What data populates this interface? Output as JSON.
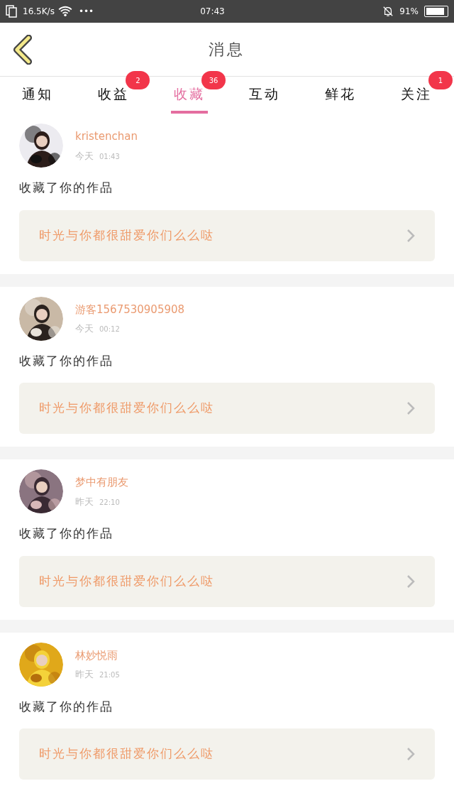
{
  "status_bar": {
    "speed": "16.5K/s",
    "dots": "•••",
    "time": "07:43",
    "battery": "91%"
  },
  "header": {
    "title": "消息"
  },
  "tabs": [
    {
      "label": "通知",
      "selected": false
    },
    {
      "label": "收益",
      "selected": false,
      "badge": "2"
    },
    {
      "label": "收藏",
      "selected": true,
      "badge": "36"
    },
    {
      "label": "互动",
      "selected": false
    },
    {
      "label": "鲜花",
      "selected": false
    },
    {
      "label": "关注",
      "selected": false,
      "badge": "1"
    }
  ],
  "messages": [
    {
      "user": "kristenchan",
      "day": "今天",
      "time": "01:43",
      "action": "收藏了你的作品",
      "work": "时光与你都很甜爱你们么么哒"
    },
    {
      "user": "游客1567530905908",
      "day": "今天",
      "time": "00:12",
      "action": "收藏了你的作品",
      "work": "时光与你都很甜爱你们么么哒"
    },
    {
      "user": "梦中有朋友",
      "day": "昨天",
      "time": "22:10",
      "action": "收藏了你的作品",
      "work": "时光与你都很甜爱你们么么哒"
    },
    {
      "user": "林妙悦雨",
      "day": "昨天",
      "time": "21:05",
      "action": "收藏了你的作品",
      "work": "时光与你都很甜爱你们么么哒"
    }
  ]
}
